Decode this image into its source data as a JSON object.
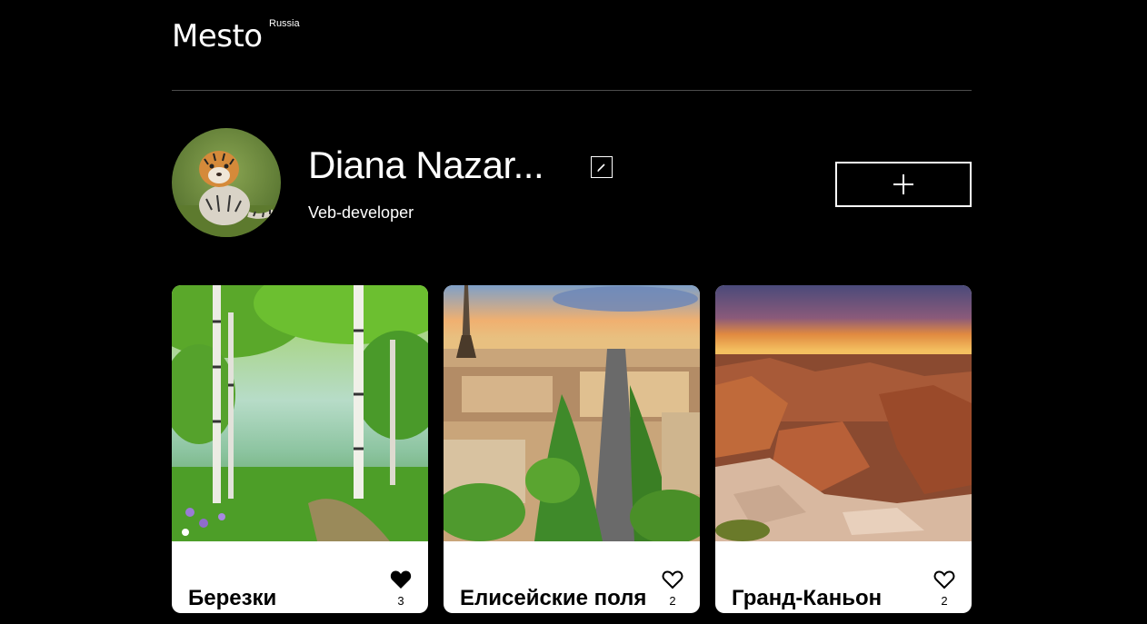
{
  "header": {
    "logo": "Mesto",
    "logo_sup": "Russia"
  },
  "profile": {
    "name": "Diana Nazar...",
    "about": "Veb-developer",
    "avatar_icon": "tiger-cub-photo",
    "edit_icon": "pencil-icon",
    "add_icon": "plus-icon"
  },
  "cards": [
    {
      "title": "Березки",
      "likes": "3",
      "liked": true,
      "image": "birch-forest-photo"
    },
    {
      "title": "Елисейские поля",
      "likes": "2",
      "liked": false,
      "image": "paris-champs-elysees-photo"
    },
    {
      "title": "Гранд-Каньон",
      "likes": "2",
      "liked": false,
      "image": "grand-canyon-sunset-photo"
    }
  ],
  "colors": {
    "background": "#000000",
    "card": "#ffffff",
    "divider": "#545454"
  }
}
